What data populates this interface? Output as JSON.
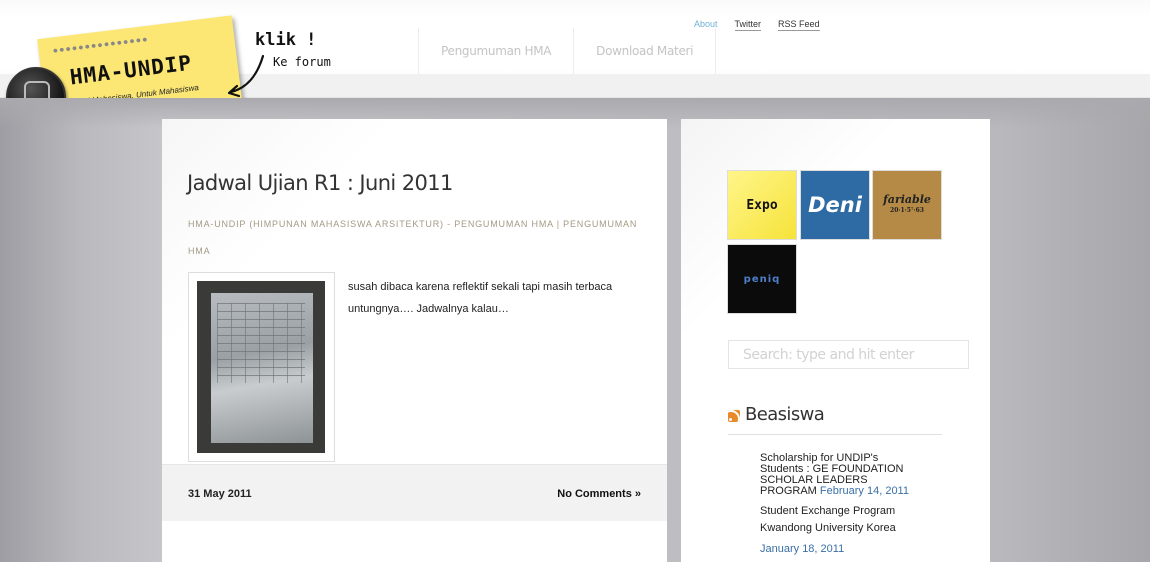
{
  "header": {
    "logo": {
      "title": "HMA-UNDIP",
      "tagline": "Dari Mahasiswa, Untuk Mahasiswa",
      "callout_main": "klik !",
      "callout_sub": "Ke forum"
    },
    "main_nav": [
      "Pengumuman HMA",
      "Download Materi"
    ],
    "top_nav": [
      {
        "label": "About",
        "active": true
      },
      {
        "label": "Twitter",
        "active": false
      },
      {
        "label": "RSS Feed",
        "active": false
      }
    ]
  },
  "post": {
    "title": "Jadwal Ujian R1 : Juni 2011",
    "meta": "HMA-UNDIP (HIMPUNAN MAHASISWA ARSITEKTUR) - PENGUMUMAN HMA | PENGUMUMAN HMA",
    "excerpt": "susah dibaca karena reflektif sekali tapi masih terbaca untungnya…. Jadwalnya kalau…",
    "date": "31 May 2011",
    "comments": "No Comments »"
  },
  "sidebar": {
    "banners": [
      {
        "label": "Expo"
      },
      {
        "label": "Deni"
      },
      {
        "label": "fariable",
        "sub": "20·1·5⁷·63"
      },
      {
        "label": "peniq"
      }
    ],
    "search": {
      "placeholder": "Search: type and hit enter"
    },
    "widget": {
      "title": "Beasiswa",
      "items": [
        {
          "text": "Scholarship for UNDIP's Students : GE FOUNDATION SCHOLAR LEADERS PROGRAM",
          "date": "February 14, 2011"
        },
        {
          "text": "Student Exchange Program Kwandong University Korea",
          "date": "January 18, 2011"
        }
      ]
    }
  },
  "colors": {
    "sticky_note": "#fce774",
    "meta_text": "#a29a86",
    "link_active": "#6fb3d8",
    "feed_date": "#3a6fa5",
    "page_band": "#b9b9be"
  }
}
